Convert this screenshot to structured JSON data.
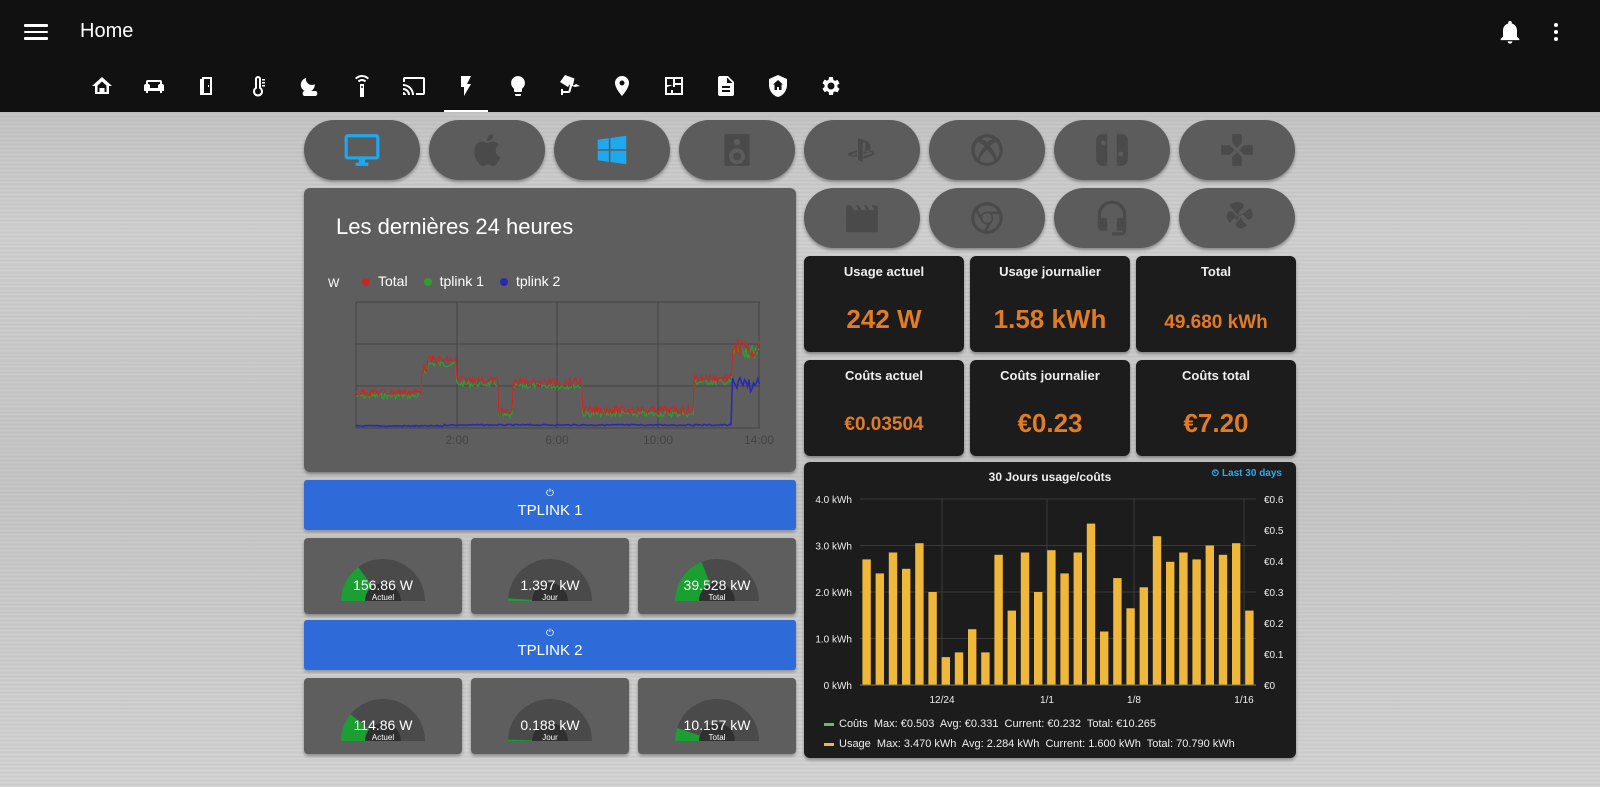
{
  "header": {
    "title": "Home"
  },
  "tabs": [
    {
      "icon": "home-automation-icon"
    },
    {
      "icon": "sofa-icon"
    },
    {
      "icon": "door-icon"
    },
    {
      "icon": "thermometer-icon"
    },
    {
      "icon": "weather-night-icon"
    },
    {
      "icon": "remote-icon"
    },
    {
      "icon": "cast-icon"
    },
    {
      "icon": "flash-icon",
      "active": true
    },
    {
      "icon": "lightbulb-icon"
    },
    {
      "icon": "cctv-icon"
    },
    {
      "icon": "map-marker-icon"
    },
    {
      "icon": "floor-plan-icon"
    },
    {
      "icon": "file-document-icon"
    },
    {
      "icon": "shield-home-icon"
    },
    {
      "icon": "settings-icon"
    }
  ],
  "devices": [
    {
      "icon": "monitor-icon",
      "active": true
    },
    {
      "icon": "apple-icon"
    },
    {
      "icon": "windows-icon",
      "active": true
    },
    {
      "icon": "speaker-icon"
    },
    {
      "icon": "playstation-icon"
    },
    {
      "icon": "xbox-icon"
    },
    {
      "icon": "nintendo-switch-icon"
    },
    {
      "icon": "gamepad-icon"
    },
    {
      "icon": "movie-icon"
    },
    {
      "icon": "chrome-icon"
    },
    {
      "icon": "headphones-icon"
    },
    {
      "icon": "fan-icon"
    }
  ],
  "history": {
    "title": "Les dernières 24 heures",
    "unit": "W",
    "legend": [
      {
        "name": "Total",
        "color": "#c62828"
      },
      {
        "name": "tplink 1",
        "color": "#2e9e2e"
      },
      {
        "name": "tplink 2",
        "color": "#2a2ab0"
      }
    ],
    "xticks": [
      "2:00",
      "6:00",
      "10:00",
      "14:00"
    ]
  },
  "stats": [
    {
      "label": "Usage actuel",
      "value": "242 W"
    },
    {
      "label": "Usage journalier",
      "value": "1.58 kWh"
    },
    {
      "label": "Total",
      "value": "49.680 kWh"
    },
    {
      "label": "Coûts actuel",
      "value": "€0.03504"
    },
    {
      "label": "Coûts journalier",
      "value": "€0.23"
    },
    {
      "label": "Coûts total",
      "value": "€7.20"
    }
  ],
  "tplink1": {
    "power_symbol": "⏻",
    "label": "TPLINK 1",
    "gauges": [
      {
        "value": "156.86 W",
        "sub": "Actuel",
        "fraction": 0.3
      },
      {
        "value": "1.397 kW",
        "sub": "Jour",
        "fraction": 0.02
      },
      {
        "value": "39.528 kW",
        "sub": "Total",
        "fraction": 0.38
      }
    ]
  },
  "tplink2": {
    "power_symbol": "⏻",
    "label": "TPLINK 2",
    "gauges": [
      {
        "value": "114.86 W",
        "sub": "Actuel",
        "fraction": 0.22
      },
      {
        "value": "0.188 kW",
        "sub": "Jour",
        "fraction": 0.01
      },
      {
        "value": "10.157 kW",
        "sub": "Total",
        "fraction": 0.1
      }
    ]
  },
  "chart_data": {
    "type": "bar",
    "title": "30 Jours usage/coûts",
    "range_label": "Last 30 days",
    "y_left_ticks": [
      "4.0 kWh",
      "3.0 kWh",
      "2.0 kWh",
      "1.0 kWh",
      "0 kWh"
    ],
    "y_right_ticks": [
      "€0.6",
      "€0.5",
      "€0.4",
      "€0.3",
      "€0.2",
      "€0.1",
      "€0"
    ],
    "ylim": [
      0,
      4
    ],
    "x_tick_labels": [
      "12/24",
      "1/1",
      "1/8",
      "1/16"
    ],
    "values": [
      2.7,
      2.4,
      2.85,
      2.5,
      3.05,
      2.0,
      0.6,
      0.7,
      1.2,
      0.7,
      2.8,
      1.6,
      2.85,
      2.0,
      2.9,
      2.4,
      2.85,
      3.47,
      1.15,
      2.3,
      1.65,
      2.1,
      3.2,
      2.65,
      2.85,
      2.7,
      3.0,
      2.8,
      3.05,
      1.6
    ],
    "legend": [
      {
        "name": "Coûts",
        "color": "#66bb6a",
        "text": "Max: €0.503  Avg: €0.331  Current: €0.232  Total: €10.265"
      },
      {
        "name": "Usage",
        "color": "#f0b83a",
        "text": "Max: 3.470 kWh  Avg: 2.284 kWh  Current: 1.600 kWh  Total: 70.790 kWh"
      }
    ]
  }
}
